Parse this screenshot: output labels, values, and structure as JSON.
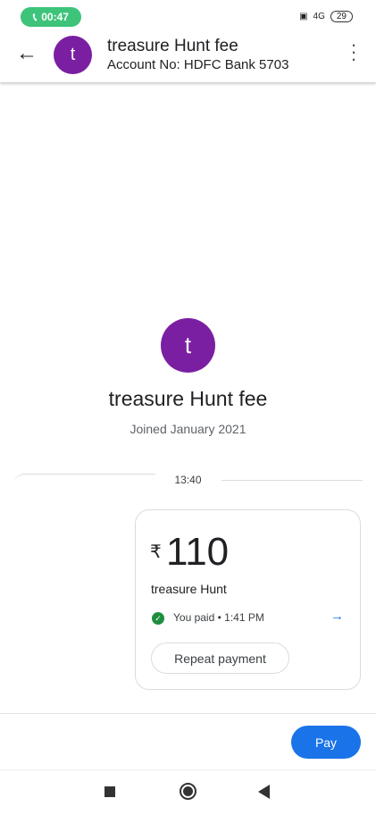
{
  "status": {
    "call_time": "00:47",
    "network": "4G",
    "battery": "29"
  },
  "header": {
    "avatar_letter": "t",
    "title": "treasure Hunt fee",
    "subtitle": "Account No: HDFC Bank 5703"
  },
  "profile": {
    "avatar_letter": "t",
    "name": "treasure Hunt fee",
    "joined": "Joined January 2021"
  },
  "chat": {
    "timestamp": "13:40",
    "payment": {
      "currency": "₹",
      "amount": "110",
      "note": "treasure Hunt",
      "status": "You paid • 1:41 PM",
      "repeat_label": "Repeat payment"
    }
  },
  "footer": {
    "pay_label": "Pay"
  },
  "colors": {
    "accent": "#1a73e8",
    "avatar": "#7b1fa2",
    "success": "#1e8e3e"
  }
}
